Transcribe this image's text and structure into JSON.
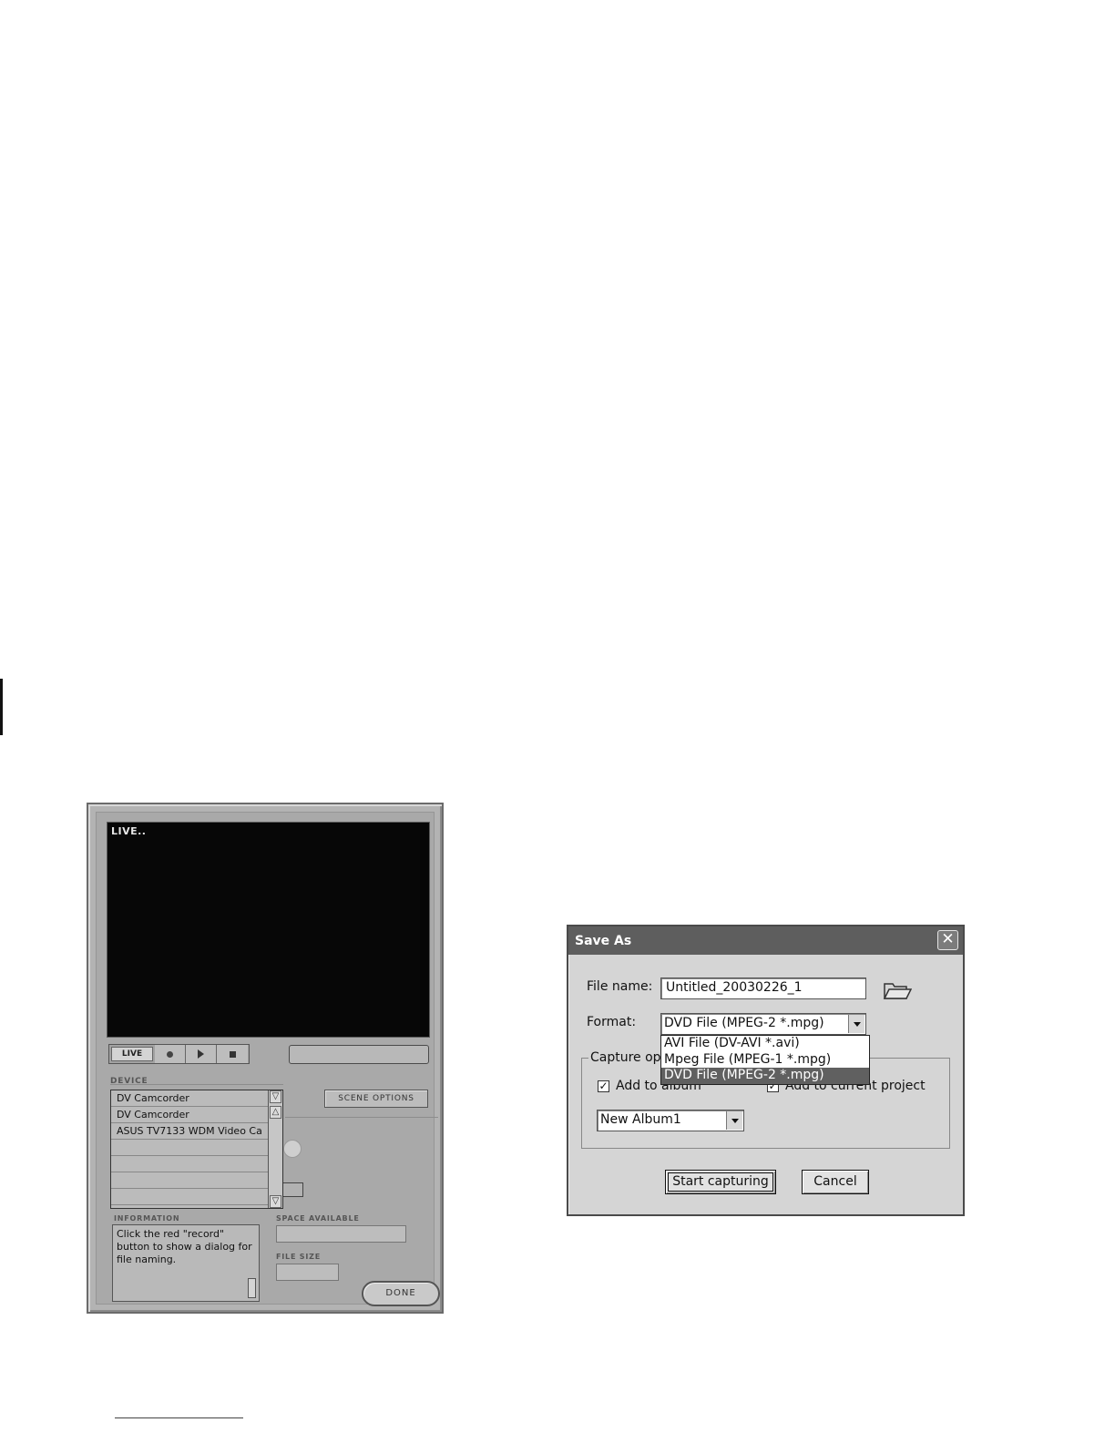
{
  "capture_panel": {
    "preview_label": "LIVE..",
    "transport": {
      "live_label": "LIVE"
    },
    "device_label": "DEVICE",
    "devices": [
      "DV Camcorder",
      "DV Camcorder",
      "ASUS TV7133 WDM Video Ca",
      "",
      "",
      "",
      ""
    ],
    "scene_options_label": "SCENE OPTIONS",
    "information_label": "INFORMATION",
    "information_text": "Click the red \"record\" button to show a dialog for file naming.",
    "space_available_label": "SPACE AVAILABLE",
    "file_size_label": "FILE SIZE",
    "done_label": "DONE"
  },
  "save_as_dialog": {
    "title": "Save As",
    "close_glyph": "✕",
    "file_name_label": "File name:",
    "file_name_value": "Untitled_20030226_1",
    "format_label": "Format:",
    "format_value": "DVD File (MPEG-2 *.mpg)",
    "format_options": [
      "AVI File (DV-AVI *.avi)",
      "Mpeg File (MPEG-1 *.mpg)",
      "DVD File (MPEG-2 *.mpg)"
    ],
    "capture_options_label": "Capture opt",
    "add_to_album_label": "Add to album",
    "add_to_album_checked": true,
    "add_to_project_label": "Add to current project",
    "add_to_project_checked": true,
    "check_glyph": "✓",
    "album_value": "New Album1",
    "start_button": "Start capturing",
    "cancel_button": "Cancel"
  },
  "icons": {
    "folder": "folder-icon",
    "record": "record-icon",
    "play": "play-icon",
    "stop": "stop-icon"
  }
}
